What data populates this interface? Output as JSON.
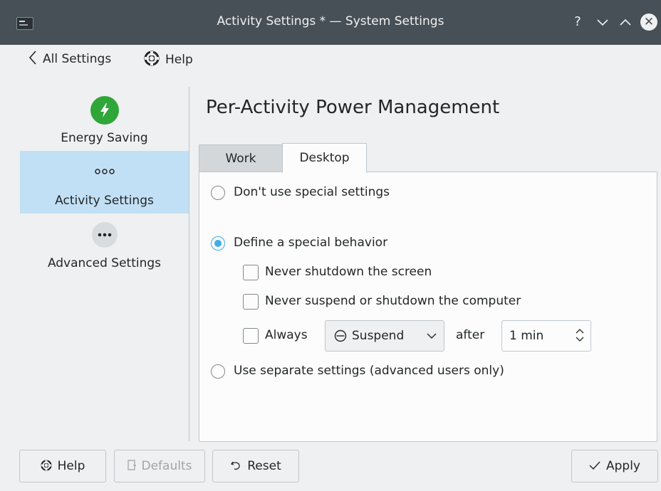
{
  "window": {
    "title": "Activity Settings * — System Settings",
    "help_glyph": "?",
    "minimize_glyph": "⌄",
    "maximize_glyph": "⌃",
    "close_glyph": "✕"
  },
  "toolbar": {
    "back_label": "All Settings",
    "help_label": "Help"
  },
  "sidebar": {
    "items": [
      {
        "label": "Energy Saving",
        "icon": "energy-saving-icon",
        "active": false
      },
      {
        "label": "Activity Settings",
        "icon": "activity-icon",
        "active": true
      },
      {
        "label": "Advanced Settings",
        "icon": "advanced-settings-icon",
        "active": false
      }
    ]
  },
  "main": {
    "title": "Per-Activity Power Management",
    "tabs": [
      {
        "label": "Work",
        "selected": false
      },
      {
        "label": "Desktop",
        "selected": true
      }
    ],
    "options": {
      "dont_use": "Don't use special settings",
      "define_special": "Define a special behavior",
      "never_shutdown_screen": "Never shutdown the screen",
      "never_suspend": "Never suspend or shutdown the computer",
      "always": "Always",
      "action_value": "Suspend",
      "after": "after",
      "time_value": "1 min",
      "separate": "Use separate settings (advanced users only)"
    },
    "selected_option": "define_special"
  },
  "footer": {
    "help_label": "Help",
    "defaults_label": "Defaults",
    "reset_label": "Reset",
    "apply_label": "Apply"
  },
  "colors": {
    "accent": "#3daee9",
    "selection": "#c2e0f5",
    "titlebar": "#475057",
    "energy_green": "#2fa638"
  }
}
